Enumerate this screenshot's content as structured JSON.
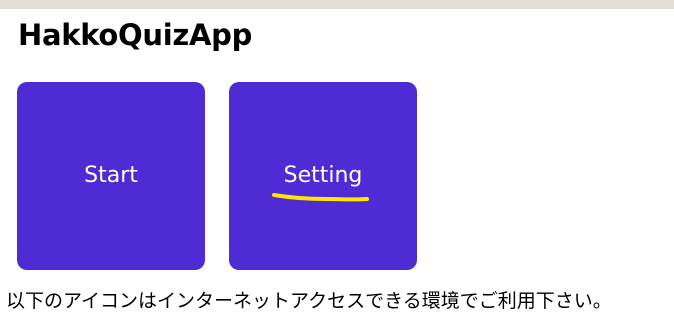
{
  "app": {
    "title": "HakkoQuizApp"
  },
  "buttons": {
    "start_label": "Start",
    "setting_label": "Setting"
  },
  "notice": {
    "text": "以下のアイコンはインターネットアクセスできる環境でご利用下さい。"
  },
  "colors": {
    "tile_background": "#4f2bd6",
    "tile_text": "#ffffff",
    "annotation_underline": "#ffe600",
    "top_strip": "#e1dcd6"
  }
}
